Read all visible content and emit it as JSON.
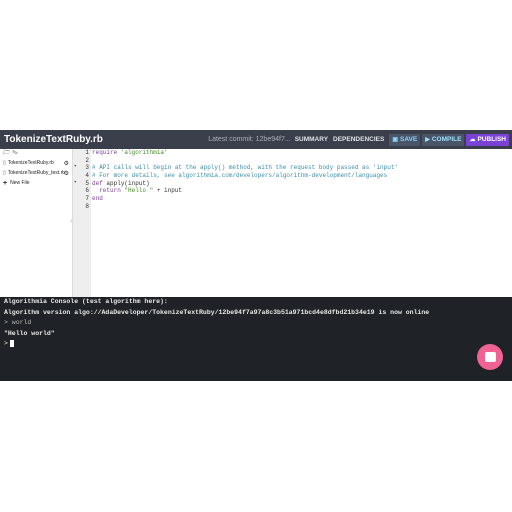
{
  "header": {
    "title": "TokenizeTextRuby.rb",
    "commit": "Latest commit: 12be94f7...",
    "summary_label": "SUMMARY",
    "dependencies_label": "DEPENDENCIES",
    "save_label": "SAVE",
    "compile_label": "COMPILE",
    "publish_label": "PUBLISH"
  },
  "sidebar": {
    "files": [
      {
        "name": "TokenizeTextRuby.rb"
      },
      {
        "name": "TokenizeTextRuby_test.rb"
      }
    ],
    "new_file_label": "New File"
  },
  "editor": {
    "line_numbers": [
      "1",
      "2",
      "3",
      "4",
      "5",
      "6",
      "7",
      "8"
    ],
    "lines": {
      "l1_kw": "require",
      "l1_str": "'algorithmia'",
      "l3": "# API calls will begin at the apply() method, with the request body passed as 'input'",
      "l4": "# For more details, see algorithmia.com/developers/algorithm-development/languages",
      "l5_kw": "def",
      "l5_rest": " apply(input)",
      "l6_kw": "  return",
      "l6_str": " \"Hello \"",
      "l6_rest": " + input",
      "l7": "end"
    }
  },
  "console": {
    "header": "Algorithmia Console (test algorithm here):",
    "status": "Algorithm version algo://AdaDeveloper/TokenizeTextRuby/12be94f7a97a8c3b51a971bcd4e8dfbd21b34e19 is now online",
    "input_prompt": "> world",
    "output": "\"Hello world\"",
    "prompt": ">"
  },
  "colors": {
    "topbar": "#3a3f4b",
    "publish": "#7b42d6",
    "console_bg": "#1f2327",
    "chat": "#f06292"
  }
}
